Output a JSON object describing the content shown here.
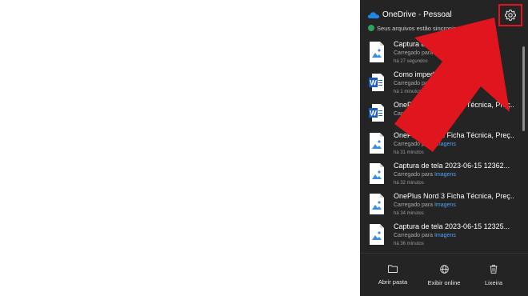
{
  "header": {
    "app_name": "OneDrive",
    "separator": " - ",
    "account": "Pessoal",
    "status": "Seus arquivos estão sincronizados"
  },
  "files": [
    {
      "name": "Captura de tela 2023-06-15 ...",
      "sub_prefix": "Carregado para ",
      "sub_link": "",
      "time": "há 27 segundos",
      "type": "image"
    },
    {
      "name": "Como impedir ...",
      "sub_prefix": "Carregado para ",
      "sub_link": "",
      "time": "há 1 minutos",
      "type": "word"
    },
    {
      "name": "OnePlus Nord 3 Ficha Técnica, Preç...",
      "sub_prefix": "Carregado para ",
      "sub_link": "",
      "time": "",
      "type": "word"
    },
    {
      "name": "OnePlus Nord 3 Ficha Técnica, Preç...",
      "sub_prefix": "Carregado para ",
      "sub_link": "Imagens",
      "time": "há 31 minutos",
      "type": "image"
    },
    {
      "name": "Captura de tela 2023-06-15 12362...",
      "sub_prefix": "Carregado para ",
      "sub_link": "Imagens",
      "time": "há 32 minutos",
      "type": "image"
    },
    {
      "name": "OnePlus Nord 3 Ficha Técnica, Preç...",
      "sub_prefix": "Carregado para ",
      "sub_link": "Imagens",
      "time": "há 34 minutos",
      "type": "image"
    },
    {
      "name": "Captura de tela 2023-06-15 12325...",
      "sub_prefix": "Carregado para ",
      "sub_link": "Imagens",
      "time": "há 36 minutos",
      "type": "image"
    }
  ],
  "footer": {
    "open_folder": "Abrir pasta",
    "view_online": "Exibir online",
    "recycle_bin": "Lixeira"
  },
  "colors": {
    "panel_bg": "#242424",
    "accent_link": "#4fa3f7",
    "sync_green": "#26a65b",
    "annotation_red": "#e0151e"
  },
  "icons": {
    "cloud": "onedrive-cloud-icon",
    "settings": "gear-icon",
    "image_file": "image-file-icon",
    "word_file": "word-file-icon",
    "folder": "folder-icon",
    "globe": "globe-icon",
    "trash": "trash-icon"
  }
}
